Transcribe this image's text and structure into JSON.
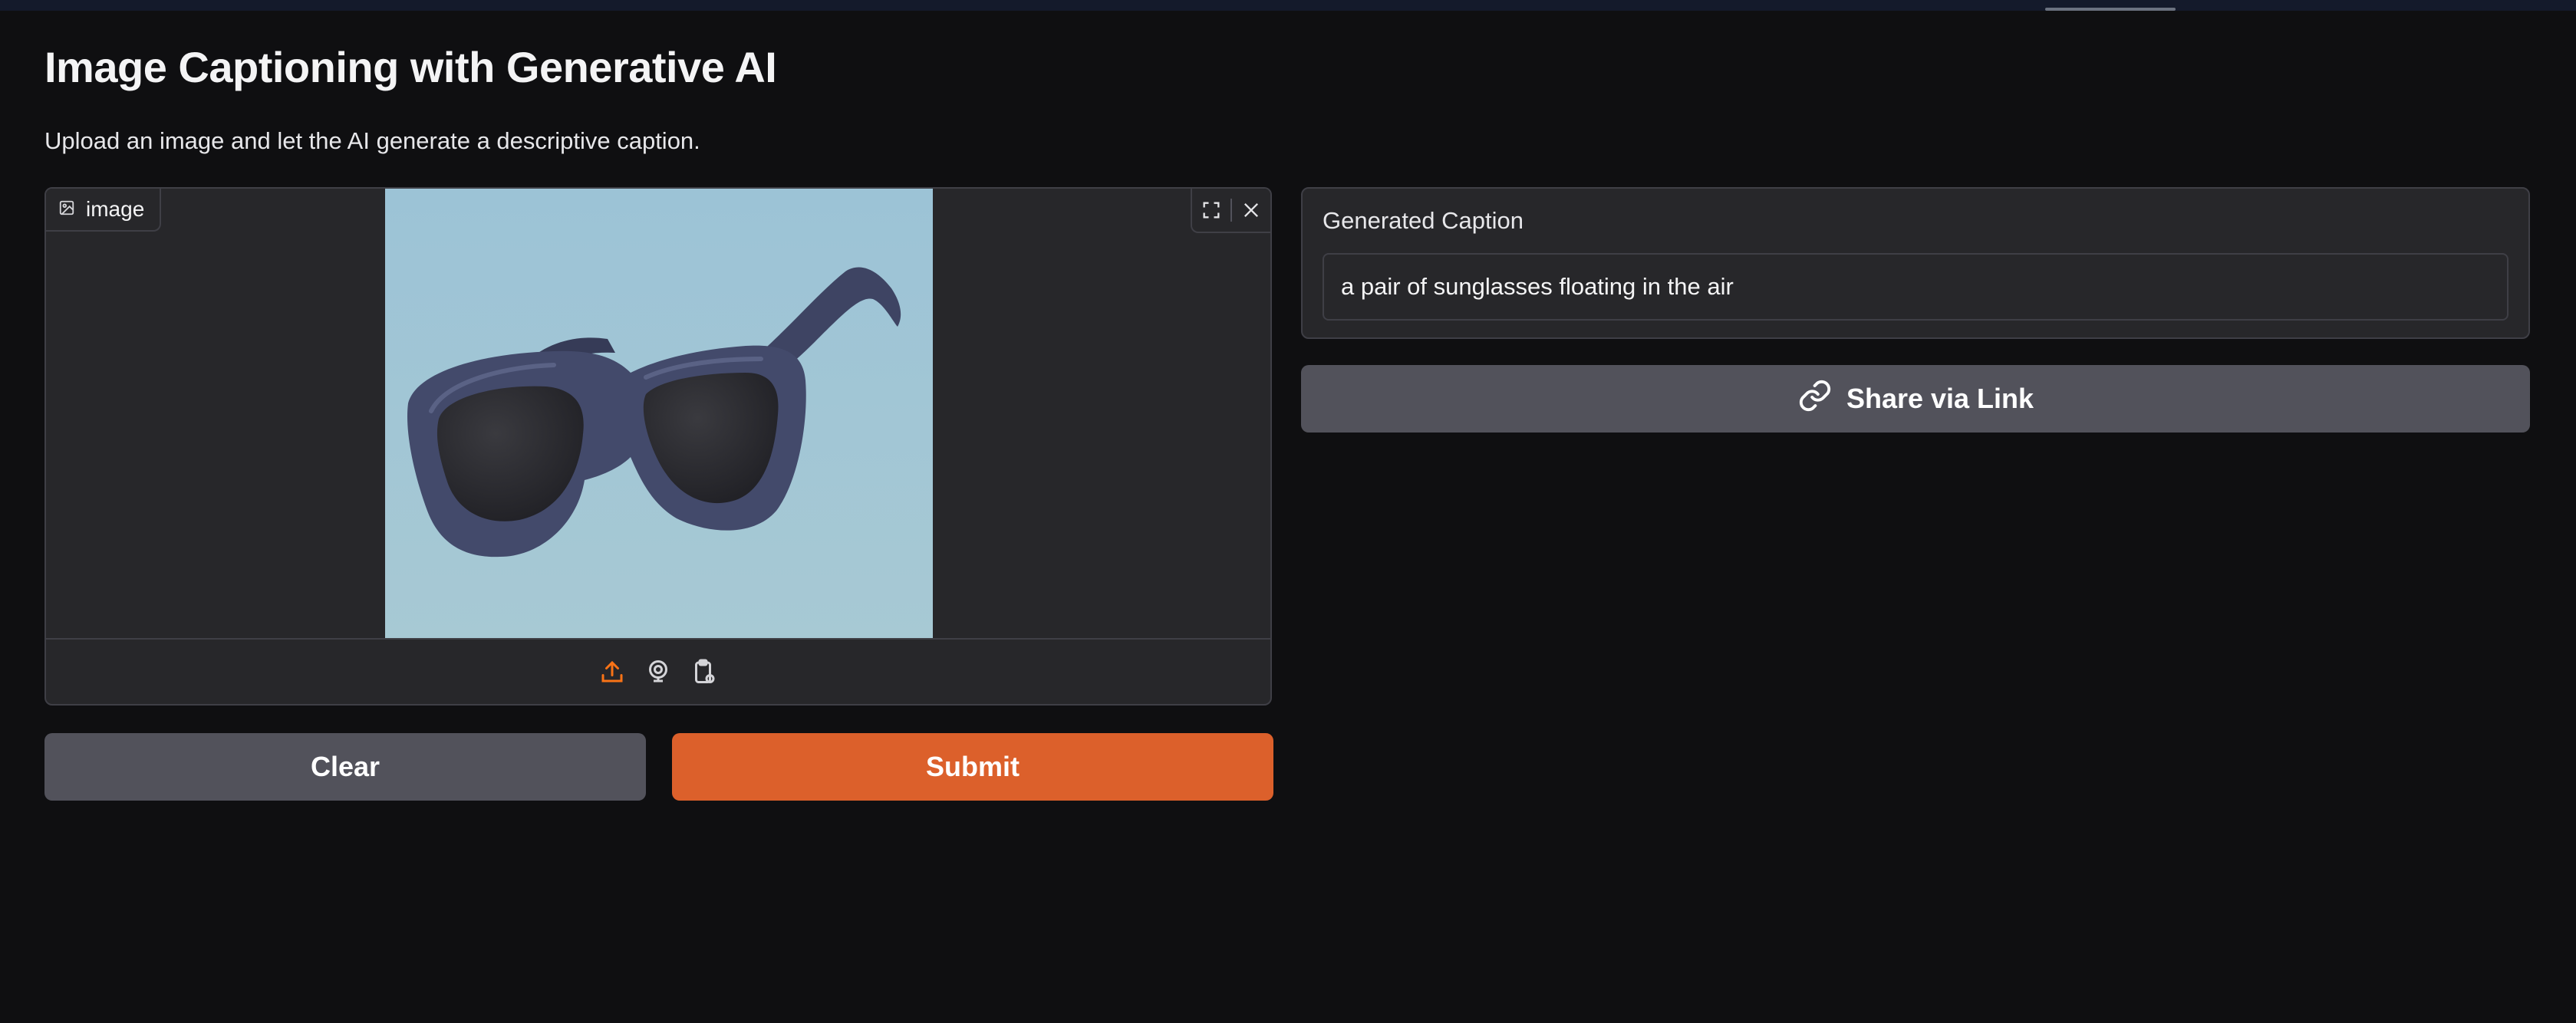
{
  "page": {
    "title": "Image Captioning with Generative AI",
    "description": "Upload an image and let the AI generate a descriptive caption."
  },
  "image_input": {
    "label": "image",
    "icons": {
      "label_icon": "image-icon",
      "fullscreen": "fullscreen-icon",
      "clear": "close-icon",
      "upload": "upload-icon",
      "webcam": "webcam-icon",
      "clipboard": "clipboard-icon"
    },
    "preview_subject": "sunglasses"
  },
  "buttons": {
    "clear": "Clear",
    "submit": "Submit",
    "share": "Share via Link"
  },
  "output": {
    "label": "Generated Caption",
    "value": "a pair of sunglasses floating in the air"
  },
  "colors": {
    "background": "#0f0f11",
    "panel": "#27272a",
    "border": "#3f3f46",
    "primary": "#dc602b",
    "secondary": "#52525b",
    "accent_icon": "#f97316"
  }
}
